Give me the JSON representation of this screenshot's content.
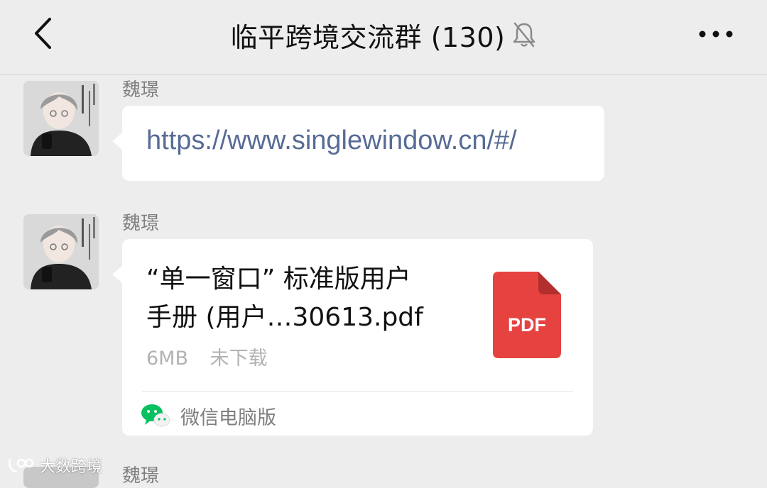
{
  "header": {
    "title": "临平跨境交流群 (130)",
    "back_icon": "chevron-left-icon",
    "mute_icon": "bell-off-icon",
    "more_icon": "more-dots-icon"
  },
  "messages": [
    {
      "sender": "魏璟",
      "type": "link",
      "text": "https://www.singlewindow.cn/#/"
    },
    {
      "sender": "魏璟",
      "type": "file",
      "file_name_line1": "“单一窗口” 标准版用户",
      "file_name_line2": "手册 (用户…30613.pdf",
      "file_size": "6MB",
      "file_status": "未下载",
      "file_icon_label": "PDF",
      "source": "微信电脑版",
      "source_icon": "wechat-icon"
    },
    {
      "sender": "魏璟"
    }
  ],
  "watermark": {
    "text": "大数跨境"
  },
  "colors": {
    "background": "#ededed",
    "link": "#576b95",
    "pdf_red": "#e64340",
    "wechat_green": "#07c160"
  }
}
